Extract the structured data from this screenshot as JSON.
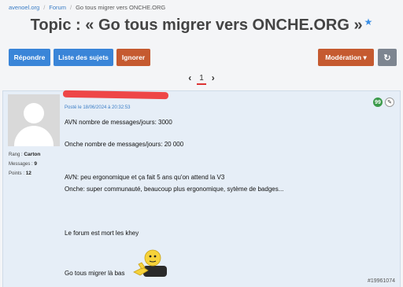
{
  "breadcrumb": {
    "site": "avenoel.org",
    "sep1": "/",
    "forum": "Forum",
    "sep2": "/",
    "topic": "Go tous migrer vers ONCHE.ORG"
  },
  "title": {
    "text": "Topic : « Go tous migrer vers ONCHE.ORG »",
    "star": "★"
  },
  "toolbar": {
    "reply": "Répondre",
    "subjects": "Liste des sujets",
    "ignore": "Ignorer",
    "moderation": "Modération ▾",
    "refresh": "↻"
  },
  "pager": {
    "prev": "‹",
    "current": "1",
    "next": "›"
  },
  "user": {
    "rank_label": "Rang :",
    "rank_value": "Carton",
    "messages_label": "Messages :",
    "messages_value": "9",
    "points_label": "Points :",
    "points_value": "12"
  },
  "post": {
    "date": "Posté le 18/06/2024 à 20:32:53",
    "lines": [
      "AVN nombre de messages/jours: 3000",
      "Onche nombre de messages/jours: 20 000",
      "AVN: peu ergonomique et ça fait 5 ans qu'on attend la V3",
      "Onche: super communauté, beaucoup plus ergonomique, sytème de badges...",
      "Le forum est mort les khey",
      "Go tous migrer là bas"
    ],
    "id": "#19961074",
    "quote_icon": "99",
    "edit_icon": "✎"
  },
  "colors": {
    "primary": "#3a85d8",
    "danger": "#c55a30",
    "grey": "#7d8590",
    "post_bg": "#e6eef7",
    "quote": "#3b9a4a"
  }
}
